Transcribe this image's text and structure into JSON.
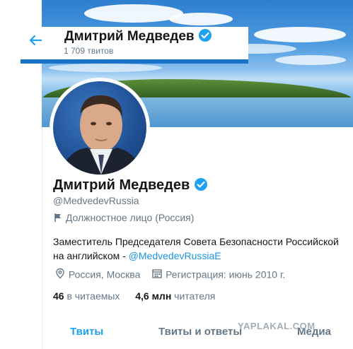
{
  "header": {
    "name": "Дмитрий Медведев",
    "tweet_count": "1 709 твитов",
    "back_icon": "arrow-left-icon"
  },
  "profile": {
    "name": "Дмитрий Медведев",
    "handle": "@MedvedevRussia",
    "label": "Должностное лицо (Россия)",
    "bio_text": "Заместитель Председателя Совета Безопасности Российской",
    "bio_text2": "на английском - ",
    "bio_link": "@MedvedevRussiaE",
    "location": "Россия, Москва",
    "joined": "Регистрация: июнь 2010 г.",
    "following_count": "46",
    "following_label": "в читаемых",
    "followers_count": "4,6 млн",
    "followers_label": "читателя"
  },
  "tabs": [
    {
      "label": "Твиты",
      "active": true
    },
    {
      "label": "Твиты и ответы",
      "active": false
    },
    {
      "label": "Медиа",
      "active": false
    }
  ],
  "watermark": "YAPLAKAL.COM",
  "colors": {
    "accent": "#1da1f2",
    "link": "#1b95e0",
    "secondary_text": "#657786",
    "verified": "#1da1f2"
  }
}
